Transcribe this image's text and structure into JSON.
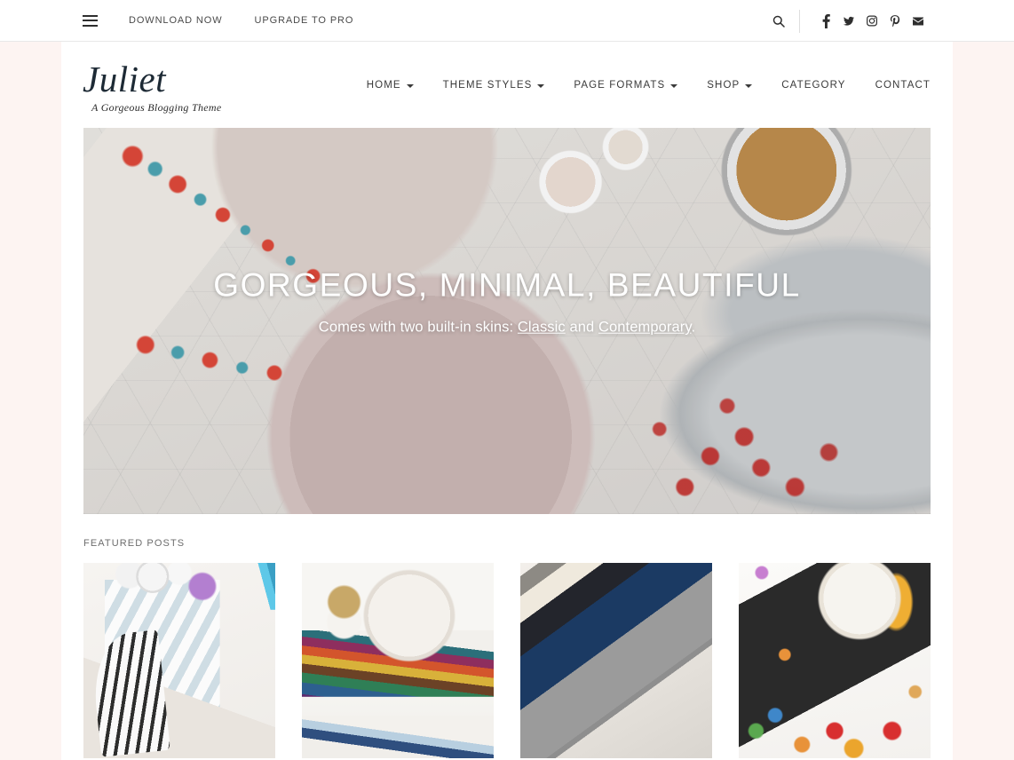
{
  "topbar": {
    "menu_icon": "hamburger-icon",
    "links": [
      {
        "label": "DOWNLOAD NOW"
      },
      {
        "label": "UPGRADE TO PRO"
      }
    ],
    "search_icon": "search-icon",
    "social": [
      {
        "name": "facebook-icon",
        "label": "Facebook"
      },
      {
        "name": "twitter-icon",
        "label": "Twitter"
      },
      {
        "name": "instagram-icon",
        "label": "Instagram"
      },
      {
        "name": "pinterest-icon",
        "label": "Pinterest"
      },
      {
        "name": "envelope-icon",
        "label": "Email"
      }
    ]
  },
  "header": {
    "logo_title": "Juliet",
    "logo_tagline": "A Gorgeous Blogging Theme",
    "nav": [
      {
        "label": "HOME",
        "has_dropdown": true
      },
      {
        "label": "THEME STYLES",
        "has_dropdown": true
      },
      {
        "label": "PAGE FORMATS",
        "has_dropdown": true
      },
      {
        "label": "SHOP",
        "has_dropdown": true
      },
      {
        "label": "CATEGORY",
        "has_dropdown": false
      },
      {
        "label": "CONTACT",
        "has_dropdown": false
      }
    ]
  },
  "hero": {
    "title": "GORGEOUS, MINIMAL, BEAUTIFUL",
    "subtitle_prefix": "Comes with two built-in skins: ",
    "link_classic": "Classic",
    "subtitle_middle": " and ",
    "link_contemporary": "Contemporary",
    "subtitle_suffix": ".",
    "image_alt": "breakfast-flatlay-waffles-blueberries-coffee"
  },
  "featured": {
    "label": "FEATURED POSTS",
    "posts": [
      {
        "alt": "planner-flatlay-striped-notebook"
      },
      {
        "alt": "fruit-bowl-on-cookbooks"
      },
      {
        "alt": "stacked-books-gold-edges"
      },
      {
        "alt": "dessert-in-dark-tray-with-candy"
      }
    ]
  },
  "colors": {
    "page_background": "#fdf4f2",
    "container_background": "#ffffff",
    "text_dark": "#2e2e2e",
    "text_muted": "#6d6d6d",
    "logo_color": "#1d2a35",
    "hero_text": "#ffffff"
  }
}
